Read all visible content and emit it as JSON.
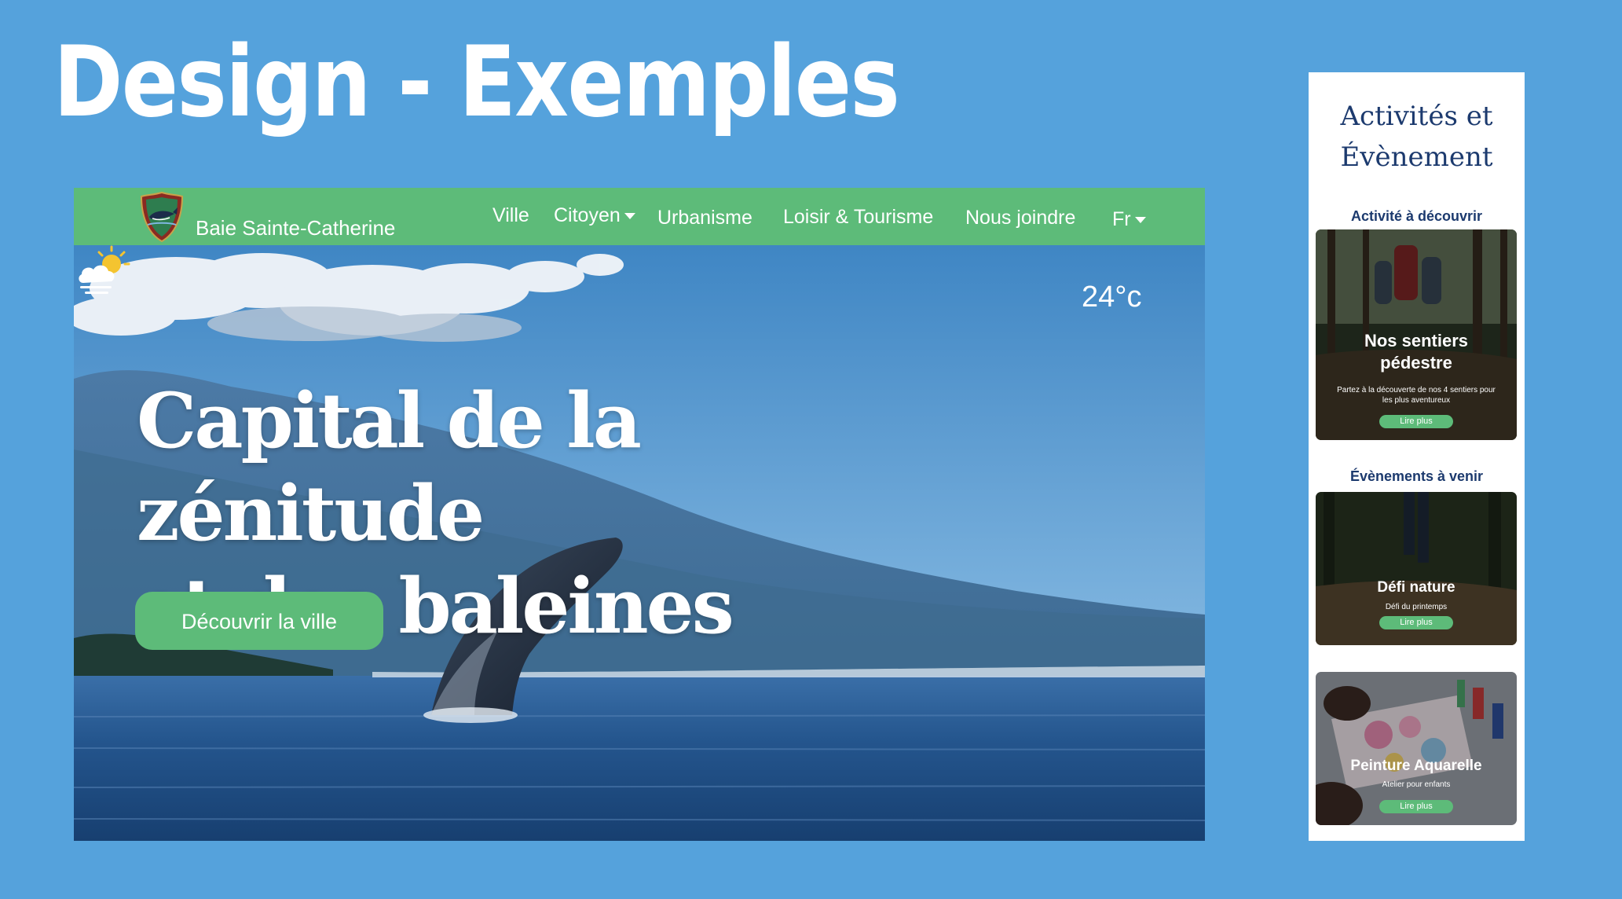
{
  "slide": {
    "title": "Design - Exemples"
  },
  "colors": {
    "background": "#55A2DC",
    "brand_green": "#5DBB79",
    "navy": "#1C3A6E"
  },
  "desktop": {
    "brand": "Baie Sainte-Catherine",
    "logo": "shield-whale-icon",
    "nav": [
      {
        "label": "Ville"
      },
      {
        "label": "Citoyen"
      },
      {
        "label": "Urbanisme"
      },
      {
        "label": "Loisir & Tourisme"
      },
      {
        "label": "Nous joindre"
      },
      {
        "label": "Fr"
      }
    ],
    "weather": {
      "icon": "cloud-sun-icon",
      "temp": "24°c"
    },
    "headline_line1": "Capital de la zénitude",
    "headline_line2": "et des baleines",
    "cta": "Découvrir la ville"
  },
  "mobile": {
    "title_line1": "Activités et",
    "title_line2": "Évènement",
    "activities_label": "Activité à découvrir",
    "events_label": "Évènements à venir",
    "cards": [
      {
        "title_line1": "Nos sentiers",
        "title_line2": "pédestre",
        "desc": "Partez à la découverte de nos 4 sentiers pour les plus aventureux",
        "button": "Lire plus"
      },
      {
        "title_line1": "Défi nature",
        "title_line2": "",
        "desc": "Défi du printemps",
        "button": "Lire plus"
      },
      {
        "title_line1": "Peinture Aquarelle",
        "title_line2": "",
        "desc": "Atelier pour enfants",
        "button": "Lire plus"
      }
    ]
  }
}
